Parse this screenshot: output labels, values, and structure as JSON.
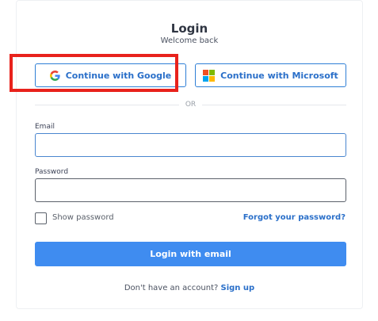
{
  "header": {
    "title": "Login",
    "subtitle": "Welcome back"
  },
  "social": {
    "google_label": "Continue with Google",
    "microsoft_label": "Continue with Microsoft"
  },
  "divider": {
    "text": "OR"
  },
  "form": {
    "email_label": "Email",
    "email_value": "",
    "password_label": "Password",
    "password_value": "",
    "show_password_label": "Show password",
    "forgot_label": "Forgot your password?",
    "submit_label": "Login with email"
  },
  "footer": {
    "prompt": "Don't have an account?",
    "signup_label": "Sign up"
  },
  "colors": {
    "accent": "#2a6fc9",
    "primary_button": "#3f8cf0",
    "highlight": "#e8221c"
  }
}
